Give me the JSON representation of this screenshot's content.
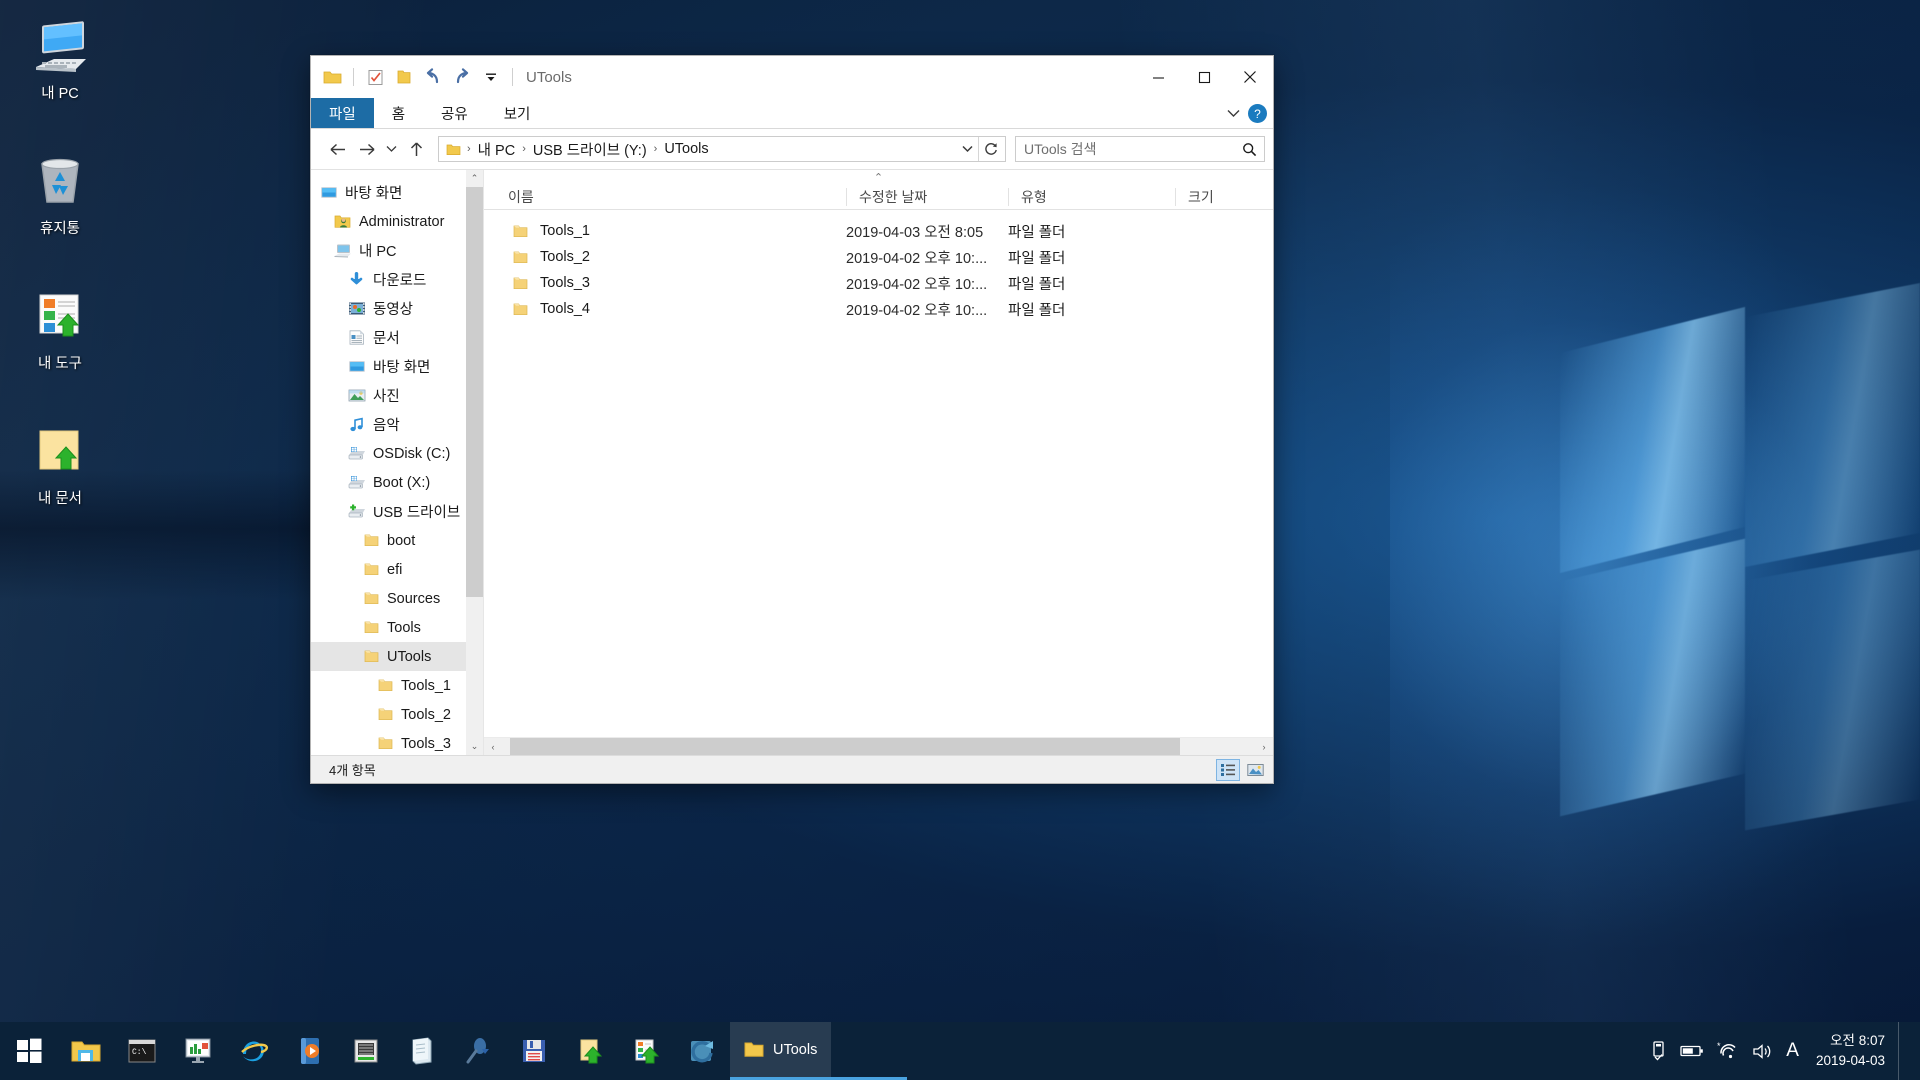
{
  "desktop": {
    "icons": [
      {
        "label": "내 PC",
        "icon": "this-pc-icon"
      },
      {
        "label": "휴지통",
        "icon": "recycle-bin-icon"
      },
      {
        "label": "내 도구",
        "icon": "my-tools-icon"
      },
      {
        "label": "내 문서",
        "icon": "my-documents-icon"
      }
    ]
  },
  "window": {
    "title": "UTools",
    "quick_access": [
      {
        "name": "folder-icon",
        "label": ""
      },
      {
        "name": "properties-icon",
        "label": ""
      },
      {
        "name": "new-folder-icon",
        "label": ""
      },
      {
        "name": "undo-icon",
        "label": ""
      },
      {
        "name": "redo-icon",
        "label": ""
      },
      {
        "name": "customize-dropdown-icon",
        "label": ""
      }
    ],
    "controls": {
      "minimize": "─",
      "maximize": "□",
      "close": "✕"
    },
    "tabs": [
      {
        "label": "파일",
        "active": true
      },
      {
        "label": "홈",
        "active": false
      },
      {
        "label": "공유",
        "active": false
      },
      {
        "label": "보기",
        "active": false
      }
    ],
    "ribbon_collapse": "⌄",
    "help_label": "?"
  },
  "nav": {
    "back": "←",
    "forward": "→",
    "recent": "⌄",
    "up": "↑",
    "breadcrumbs": [
      "내 PC",
      "USB 드라이브 (Y:)",
      "UTools"
    ],
    "breadcrumb_sep": "›",
    "dropdown": "⌄",
    "refresh": "↻"
  },
  "search": {
    "placeholder": "UTools 검색",
    "value": "",
    "icon": "search-icon"
  },
  "sidebar": {
    "items": [
      {
        "label": "바탕 화면",
        "icon": "desktop-icon",
        "indent": 0,
        "selected": false
      },
      {
        "label": "Administrator",
        "icon": "user-folder-icon",
        "indent": 1,
        "selected": false
      },
      {
        "label": "내 PC",
        "icon": "this-pc-icon",
        "indent": 1,
        "selected": false
      },
      {
        "label": "다운로드",
        "icon": "downloads-icon",
        "indent": 2,
        "selected": false
      },
      {
        "label": "동영상",
        "icon": "videos-icon",
        "indent": 2,
        "selected": false
      },
      {
        "label": "문서",
        "icon": "documents-icon",
        "indent": 2,
        "selected": false
      },
      {
        "label": "바탕 화면",
        "icon": "desktop-icon",
        "indent": 2,
        "selected": false
      },
      {
        "label": "사진",
        "icon": "pictures-icon",
        "indent": 2,
        "selected": false
      },
      {
        "label": "음악",
        "icon": "music-icon",
        "indent": 2,
        "selected": false
      },
      {
        "label": "OSDisk (C:)",
        "icon": "drive-icon",
        "indent": 2,
        "selected": false
      },
      {
        "label": "Boot (X:)",
        "icon": "drive-icon",
        "indent": 2,
        "selected": false
      },
      {
        "label": "USB 드라이브",
        "icon": "usb-drive-icon",
        "indent": 2,
        "selected": false
      },
      {
        "label": "boot",
        "icon": "folder-icon",
        "indent": 3,
        "selected": false
      },
      {
        "label": "efi",
        "icon": "folder-icon",
        "indent": 3,
        "selected": false
      },
      {
        "label": "Sources",
        "icon": "folder-icon",
        "indent": 3,
        "selected": false
      },
      {
        "label": "Tools",
        "icon": "folder-icon",
        "indent": 3,
        "selected": false
      },
      {
        "label": "UTools",
        "icon": "folder-icon",
        "indent": 3,
        "selected": true
      },
      {
        "label": "Tools_1",
        "icon": "folder-icon",
        "indent": 4,
        "selected": false
      },
      {
        "label": "Tools_2",
        "icon": "folder-icon",
        "indent": 4,
        "selected": false
      },
      {
        "label": "Tools_3",
        "icon": "folder-icon",
        "indent": 4,
        "selected": false
      }
    ]
  },
  "file_list": {
    "columns": [
      {
        "key": "name",
        "label": "이름"
      },
      {
        "key": "date",
        "label": "수정한 날짜"
      },
      {
        "key": "type",
        "label": "유형"
      },
      {
        "key": "size",
        "label": "크기"
      }
    ],
    "sort_indicator": "⌃",
    "rows": [
      {
        "name": "Tools_1",
        "date": "2019-04-03 오전 8:05",
        "type": "파일 폴더",
        "size": "",
        "icon": "folder-icon"
      },
      {
        "name": "Tools_2",
        "date": "2019-04-02 오후 10:...",
        "type": "파일 폴더",
        "size": "",
        "icon": "folder-icon"
      },
      {
        "name": "Tools_3",
        "date": "2019-04-02 오후 10:...",
        "type": "파일 폴더",
        "size": "",
        "icon": "folder-icon"
      },
      {
        "name": "Tools_4",
        "date": "2019-04-02 오후 10:...",
        "type": "파일 폴더",
        "size": "",
        "icon": "folder-icon"
      }
    ]
  },
  "status": {
    "item_count": "4개 항목",
    "view_details": "details-view-icon",
    "view_large": "large-icons-view-icon"
  },
  "scroll": {
    "up_arrow": "⌃",
    "down_arrow": "⌄",
    "left_arrow": "‹",
    "right_arrow": "›"
  },
  "taskbar": {
    "start": "start-button",
    "pinned": [
      {
        "name": "file-explorer-icon"
      },
      {
        "name": "command-prompt-icon"
      },
      {
        "name": "monitor-chart-icon"
      },
      {
        "name": "internet-explorer-icon"
      },
      {
        "name": "media-player-icon"
      },
      {
        "name": "hardware-info-icon"
      },
      {
        "name": "notepad-icon"
      },
      {
        "name": "magnifier-icon"
      },
      {
        "name": "floppy-save-icon"
      },
      {
        "name": "folder-upload-icon"
      },
      {
        "name": "tools-upload-icon"
      },
      {
        "name": "refresh-app-icon"
      }
    ],
    "open_window": {
      "label": "UTools",
      "icon": "folder-icon"
    },
    "tray": [
      {
        "name": "usb-eject-icon"
      },
      {
        "name": "battery-icon"
      },
      {
        "name": "network-wifi-icon"
      },
      {
        "name": "volume-icon"
      },
      {
        "name": "ime-icon",
        "label": "A"
      }
    ],
    "clock": {
      "time": "오전 8:07",
      "date": "2019-04-03"
    }
  },
  "colors": {
    "accent": "#1d6ca5",
    "taskbar": "#0b2239",
    "selection": "#e5e5e5",
    "folder": "#f5d278",
    "help": "#1b7bbf"
  }
}
